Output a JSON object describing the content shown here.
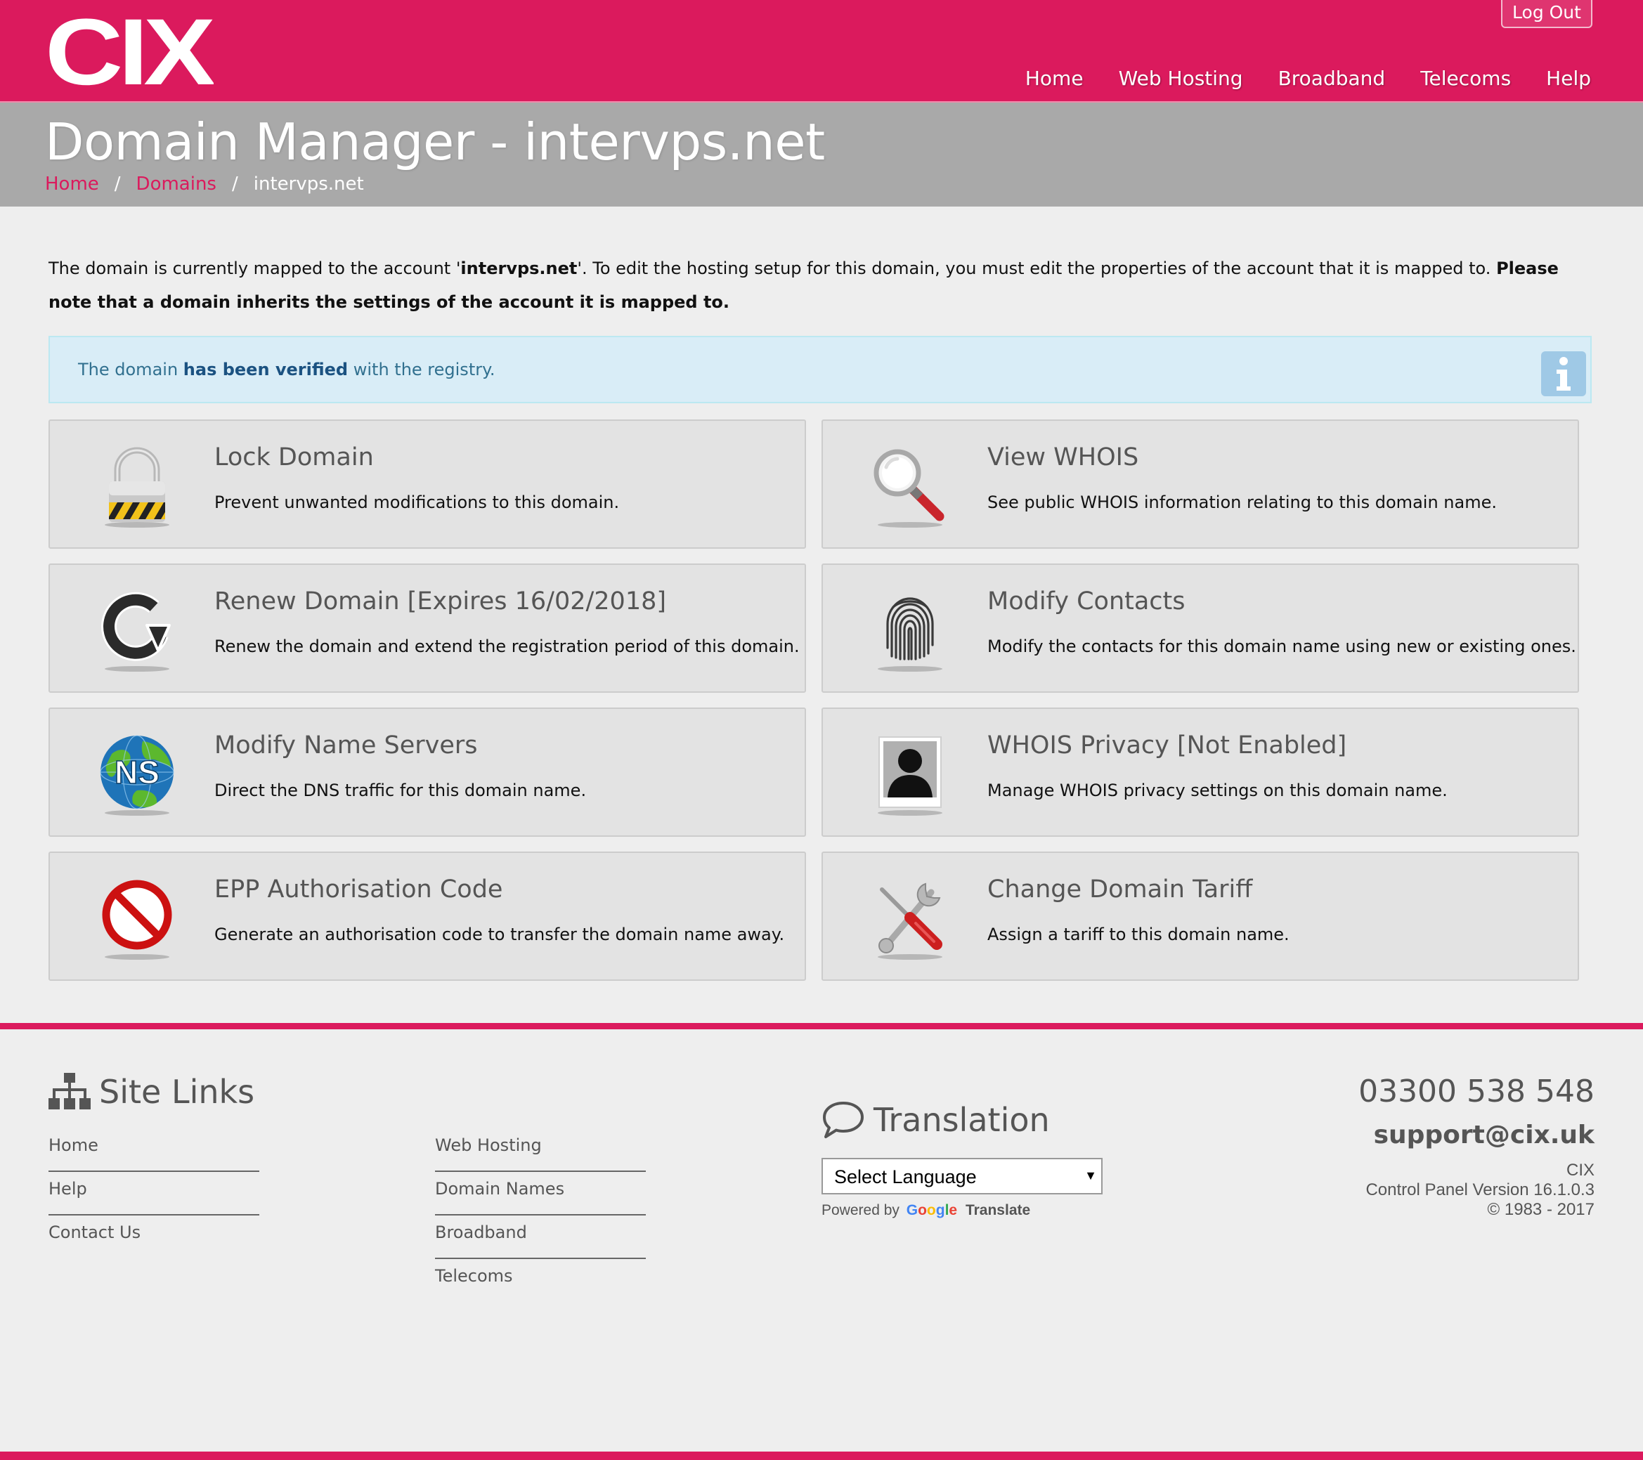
{
  "brand": {
    "logo_text": "CIX",
    "accent": "#db1a5d"
  },
  "header": {
    "logout_label": "Log Out",
    "nav": [
      "Home",
      "Web Hosting",
      "Broadband",
      "Telecoms",
      "Help"
    ]
  },
  "banner": {
    "title": "Domain Manager - intervps.net",
    "breadcrumb": {
      "home": "Home",
      "domains": "Domains",
      "separator": "/",
      "current": "intervps.net"
    }
  },
  "intro": {
    "part1": "The domain is currently mapped to the account '",
    "account": "intervps.net",
    "part2": "'. To edit the hosting setup for this domain, you must edit the properties of the account that it is mapped to. ",
    "note": "Please note that a domain inherits the settings of the account it is mapped to."
  },
  "alert": {
    "prefix": "The domain ",
    "status": "has been verified",
    "suffix": " with the registry.",
    "icon": "info-icon"
  },
  "tiles": [
    {
      "icon": "padlock-icon",
      "title": "Lock Domain",
      "desc": "Prevent unwanted modifications to this domain."
    },
    {
      "icon": "magnifier-icon",
      "title": "View WHOIS",
      "desc": "See public WHOIS information relating to this domain name."
    },
    {
      "icon": "renew-icon",
      "title": "Renew Domain [Expires 16/02/2018]",
      "desc": "Renew the domain and extend the registration period of this domain."
    },
    {
      "icon": "fingerprint-icon",
      "title": "Modify Contacts",
      "desc": "Modify the contacts for this domain name using new or existing ones."
    },
    {
      "icon": "globe-ns-icon",
      "title": "Modify Name Servers",
      "desc": "Direct the DNS traffic for this domain name.",
      "icon_text": "NS"
    },
    {
      "icon": "silhouette-icon",
      "title": "WHOIS Privacy [Not Enabled]",
      "desc": "Manage WHOIS privacy settings on this domain name."
    },
    {
      "icon": "no-entry-icon",
      "title": "EPP Authorisation Code",
      "desc": "Generate an authorisation code to transfer the domain name away."
    },
    {
      "icon": "tools-icon",
      "title": "Change Domain Tariff",
      "desc": "Assign a tariff to this domain name."
    }
  ],
  "footer": {
    "site_links_title": "Site Links",
    "links_col1": [
      "Home",
      "Help",
      "Contact Us"
    ],
    "links_col2": [
      "Web Hosting",
      "Domain Names",
      "Broadband",
      "Telecoms"
    ],
    "translation_title": "Translation",
    "language_select": "Select Language",
    "powered_by": "Powered by",
    "google": [
      "G",
      "o",
      "o",
      "g",
      "l",
      "e"
    ],
    "translate_word": "Translate",
    "phone": "03300 538 548",
    "email": "support@cix.uk",
    "company": "CIX",
    "version": "Control Panel Version 16.1.0.3",
    "copyright": "© 1983 - 2017"
  }
}
